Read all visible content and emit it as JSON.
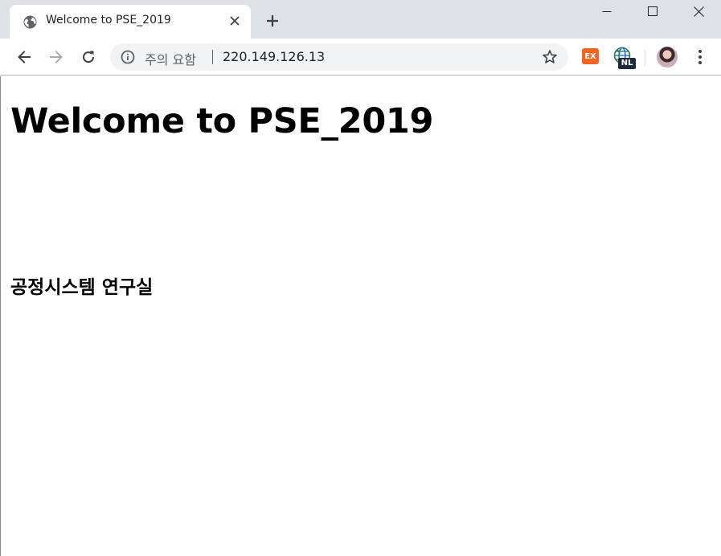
{
  "browser": {
    "tab": {
      "title": "Welcome to PSE_2019",
      "favicon": "globe-icon",
      "close_icon": "close-icon"
    },
    "new_tab_icon": "plus-icon",
    "window_controls": [
      "minimize-icon",
      "maximize-icon",
      "close-icon"
    ],
    "toolbar": {
      "back_icon": "arrow-left-icon",
      "forward_icon": "arrow-right-icon",
      "reload_icon": "reload-icon",
      "omnibox": {
        "security_text": "주의 요함",
        "url": "220.149.126.13",
        "info_icon": "info-icon",
        "bookmark_icon": "star-icon"
      },
      "extensions": [
        {
          "name": "ex-extension-icon",
          "label": "EX",
          "color": "#f26522"
        },
        {
          "name": "nl-extension-icon",
          "label": "NL",
          "color": "#1f2a3d"
        }
      ],
      "menu_icon": "kebab-menu-icon"
    }
  },
  "page": {
    "heading": "Welcome to PSE_2019",
    "subheading": "공정시스템 연구실"
  }
}
